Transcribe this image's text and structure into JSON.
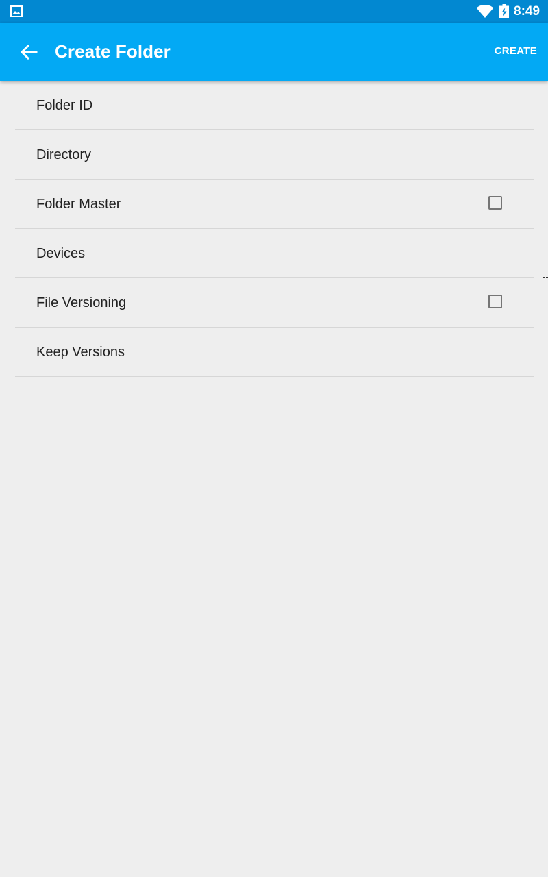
{
  "status_bar": {
    "time": "8:49",
    "icons": [
      "gallery-icon",
      "wifi-icon",
      "battery-charging-icon"
    ]
  },
  "app_bar": {
    "title": "Create Folder",
    "action_label": "CREATE",
    "back_icon": "arrow-left-icon"
  },
  "settings": [
    {
      "label": "Folder ID",
      "has_checkbox": false
    },
    {
      "label": "Directory",
      "has_checkbox": false
    },
    {
      "label": "Folder Master",
      "has_checkbox": true,
      "checked": false
    },
    {
      "label": "Devices",
      "has_checkbox": false
    },
    {
      "label": "File Versioning",
      "has_checkbox": true,
      "checked": false
    },
    {
      "label": "Keep Versions",
      "has_checkbox": false
    }
  ],
  "colors": {
    "status_bar": "#0288d1",
    "app_bar": "#03a9f4",
    "background": "#eeeeee",
    "divider": "#d6d6d6",
    "text": "#222222",
    "checkbox_border": "#757575"
  }
}
